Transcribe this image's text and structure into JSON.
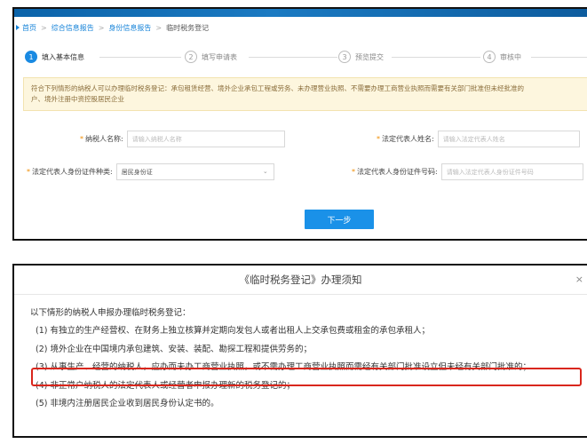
{
  "breadcrumb": {
    "items": [
      "首页",
      "综合信息报告",
      "身份信息报告",
      "临时税务登记"
    ],
    "separator": ">"
  },
  "steps": [
    {
      "num": "1",
      "label": "填入基本信息",
      "active": true
    },
    {
      "num": "2",
      "label": "填写申请表",
      "active": false
    },
    {
      "num": "3",
      "label": "预览提交",
      "active": false
    },
    {
      "num": "4",
      "label": "审核中",
      "active": false
    }
  ],
  "notice": {
    "line1": "符合下列情形的纳税人可以办理临时税务登记：承包租赁经营、境外企业承包工程或劳务、未办理营业执照、不需要办理工商营业执照而需要有关部门批准但未经批准的",
    "line2": "户、境外注册中资控股居民企业"
  },
  "form": {
    "taxpayer_name_label": "纳税人名称:",
    "taxpayer_name_placeholder": "请输入纳税人名称",
    "legal_rep_name_label": "法定代表人姓名:",
    "legal_rep_name_placeholder": "请输入法定代表人姓名",
    "id_type_label": "法定代表人身份证件种类:",
    "id_type_value": "居民身份证",
    "id_number_label": "法定代表人身份证件号码:",
    "id_number_placeholder": "请输入法定代表人身份证件号码",
    "required_mark": "*"
  },
  "next_button": "下一步",
  "notice_dialog": {
    "title": "《临时税务登记》办理须知",
    "intro": "以下情形的纳税人申报办理临时税务登记：",
    "items": [
      "(1) 有独立的生产经营权、在财务上独立核算并定期向发包人或者出租人上交承包费或租金的承包承租人；",
      "(2) 境外企业在中国境内承包建筑、安装、装配、勘探工程和提供劳务的；",
      "(3) 从事生产、经营的纳税人，应办而未办工商营业执照，或不需办理工商营业执照而需经有关部门批准设立但未经有关部门批准的；",
      "(4) 非正常户纳税人的法定代表人或经营者申报办理新的税务登记的；",
      "(5) 非境内注册居民企业收到居民身份认定书的。"
    ],
    "highlighted_item_index": 2,
    "highlight_color": "#d9261c"
  },
  "colors": {
    "accent": "#1a91e8",
    "header": "#0b63a9",
    "notice_bg": "#fdf6de"
  }
}
